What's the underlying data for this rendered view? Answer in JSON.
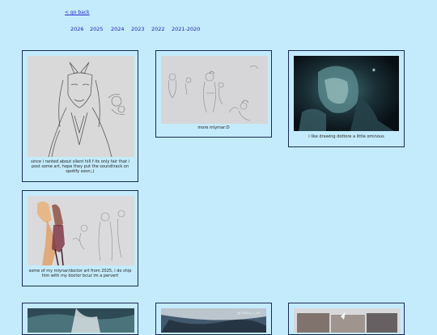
{
  "nav": {
    "back_label": "< go back",
    "years": [
      "2026",
      "2025",
      "2024",
      "2023",
      "2022",
      "2021-2020"
    ]
  },
  "posts": [
    {
      "caption": "since i ranted about silent hill f its only fair that i post some art, hope they put the soundtrack on spotify soon;,("
    },
    {
      "caption": "more mlymar:D"
    },
    {
      "caption": "i like drawing dottore a little ominous"
    },
    {
      "caption": "some of my mlynar/doctor art from 2025, i do ship him with my doctor bcuz im a pervert"
    }
  ],
  "partial_posts": [
    {
      "tag": "",
      "overlay_text": ""
    },
    {
      "tag": "",
      "overlay_text": "@ kazuo_s_art"
    },
    {
      "tag": "",
      "overlay_text": ""
    }
  ],
  "colors": {
    "background": "#c4ebfb",
    "link": "#2a2ac8",
    "card_border": "#1a2a55"
  }
}
